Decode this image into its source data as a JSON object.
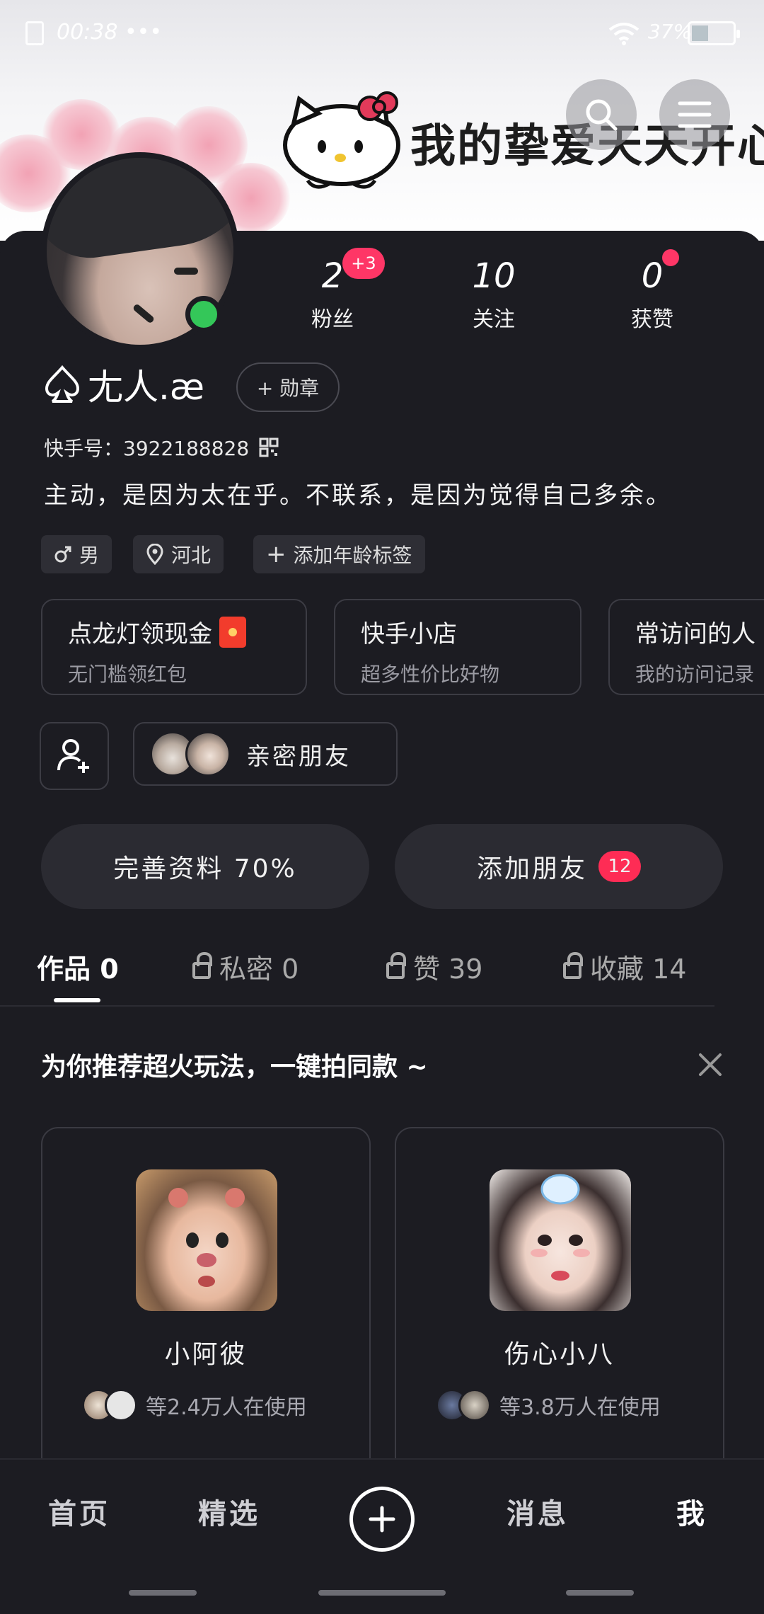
{
  "status_bar": {
    "time": "00:38 •••",
    "battery": "37%"
  },
  "banner": {
    "text": "我的挚爱天天开心"
  },
  "profile": {
    "stats": [
      {
        "value": "2",
        "label": "粉丝"
      },
      {
        "value": "10",
        "label": "关注"
      },
      {
        "value": "0",
        "label": "获赞"
      }
    ],
    "new_fans_badge": "+3",
    "name": "尢人.æ",
    "medal_button": "+ 勋章",
    "kuaishou_id": "快手号：3922188828",
    "bio": "主动，是因为太在乎。不联系，是因为觉得自己多余。",
    "tags": [
      "男",
      "河北",
      "添加年龄标签"
    ]
  },
  "cards": [
    {
      "title": "点龙灯领现金",
      "subtitle": "无门槛领红包"
    },
    {
      "title": "快手小店",
      "subtitle": "超多性价比好物"
    },
    {
      "title": "常访问的人",
      "subtitle": "我的访问记录"
    }
  ],
  "close_friends": {
    "label": "亲密朋友"
  },
  "actions": {
    "complete_profile": "完善资料 70%",
    "add_friends": "添加朋友",
    "add_friends_badge": "12"
  },
  "tabs": [
    {
      "label": "作品 0"
    },
    {
      "label": "私密 0"
    },
    {
      "label": "赞 39"
    },
    {
      "label": "收藏 14"
    }
  ],
  "recommend": {
    "title": "为你推荐超火玩法，一键拍同款 ~",
    "items": [
      {
        "name": "小阿彼",
        "users": "等2.4万人在使用"
      },
      {
        "name": "伤心小八",
        "users": "等3.8万人在使用"
      }
    ]
  },
  "bottom_nav": [
    "首页",
    "精选",
    "消息",
    "我"
  ],
  "colors": {
    "accent": "#fe3666",
    "online": "#34c759",
    "background": "#1c1c22"
  }
}
